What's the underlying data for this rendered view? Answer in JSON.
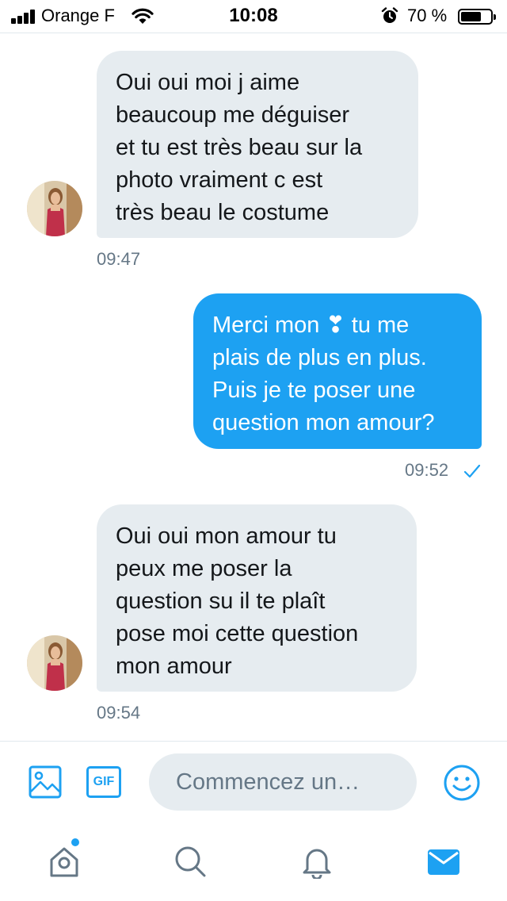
{
  "status_bar": {
    "carrier": "Orange F",
    "time": "10:08",
    "battery_percent": "70 %",
    "battery_level": 0.7,
    "icons": [
      "signal-bars-icon",
      "wifi-icon",
      "alarm-clock-icon",
      "battery-icon"
    ]
  },
  "messages": [
    {
      "direction": "received",
      "lines": [
        "Oui oui moi j aime",
        "beaucoup me déguiser",
        "et tu est très beau sur la",
        "photo vraiment c est",
        "très beau le costume"
      ],
      "time": "09:47"
    },
    {
      "direction": "sent",
      "lines": [
        "Merci mon ❣ tu me",
        "plais de plus en plus.",
        "Puis je te poser une",
        "question mon amour?"
      ],
      "time": "09:52",
      "status_icon": "check-icon"
    },
    {
      "direction": "received",
      "lines": [
        "Oui oui mon amour tu",
        "peux me poser la",
        "question su il te plaît",
        "pose moi cette question",
        "mon amour"
      ],
      "time": "09:54"
    }
  ],
  "composer": {
    "placeholder": "Commencez un…",
    "gif_label": "GIF",
    "icons": [
      "image-icon",
      "gif-icon",
      "emoji-icon"
    ]
  },
  "tabbar": {
    "items": [
      "home-icon",
      "search-icon",
      "notifications-icon",
      "messages-icon"
    ],
    "active": "messages-icon",
    "home_has_new": true
  },
  "colors": {
    "accent": "#1da1f2",
    "received_bubble": "#e6ecf0",
    "secondary_text": "#657786",
    "icon_gray": "#657786"
  }
}
